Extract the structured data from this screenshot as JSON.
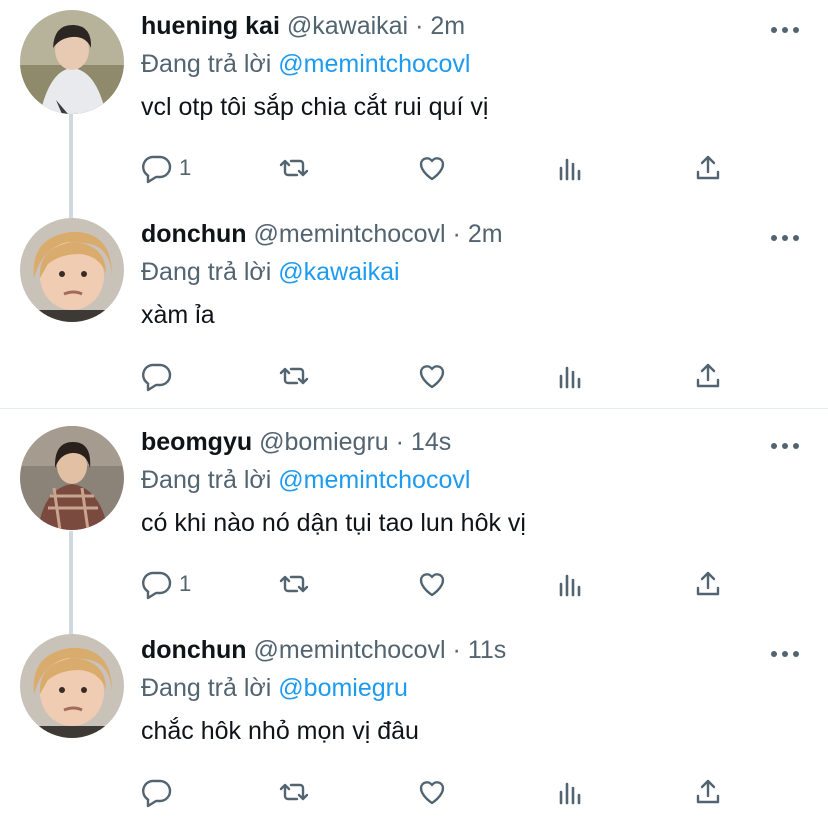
{
  "tweets": [
    {
      "name": "huening kai",
      "handle": "@kawaikai",
      "dot": "·",
      "time": "2m",
      "reply_prefix": "Đang trả lời",
      "reply_to": "@memintchocovl",
      "text": "vcl otp tôi sắp chia cắt rui quí vị",
      "reply_count": "1",
      "avatar_icon": "avatar-boy-white-hoodie"
    },
    {
      "name": "donchun",
      "handle": "@memintchocovl",
      "dot": "·",
      "time": "2m",
      "reply_prefix": "Đang trả lời",
      "reply_to": "@kawaikai",
      "text": "xàm ỉa",
      "reply_count": "",
      "avatar_icon": "avatar-blonde-child"
    },
    {
      "name": "beomgyu",
      "handle": "@bomiegru",
      "dot": "·",
      "time": "14s",
      "reply_prefix": "Đang trả lời",
      "reply_to": "@memintchocovl",
      "text": "có khi nào nó dận tụi tao lun hôk vị",
      "reply_count": "1",
      "avatar_icon": "avatar-boy-plaid-shirt"
    },
    {
      "name": "donchun",
      "handle": "@memintchocovl",
      "dot": "·",
      "time": "11s",
      "reply_prefix": "Đang trả lời",
      "reply_to": "@bomiegru",
      "text": "chắc hôk nhỏ mọn vị đâu",
      "reply_count": "",
      "avatar_icon": "avatar-blonde-child"
    }
  ],
  "colors": {
    "mention": "#1d9bf0",
    "secondary": "#536471",
    "thread_line": "#cfd9de"
  }
}
